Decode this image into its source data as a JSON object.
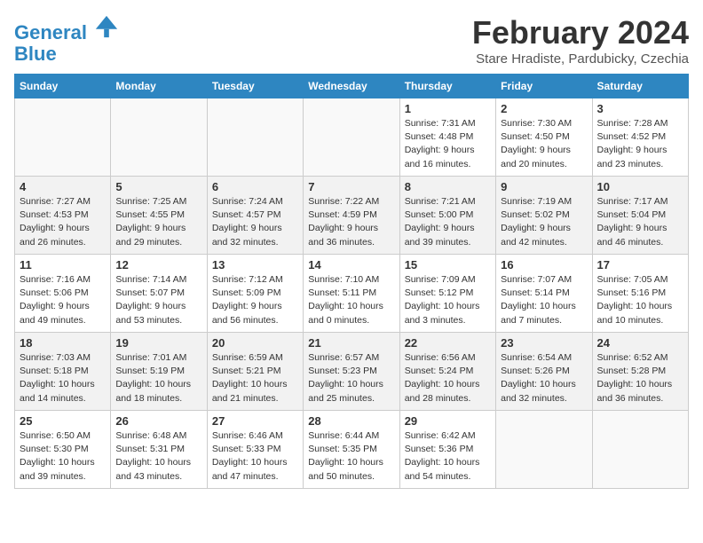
{
  "header": {
    "logo_line1": "General",
    "logo_line2": "Blue",
    "month": "February 2024",
    "location": "Stare Hradiste, Pardubicky, Czechia"
  },
  "days_of_week": [
    "Sunday",
    "Monday",
    "Tuesday",
    "Wednesday",
    "Thursday",
    "Friday",
    "Saturday"
  ],
  "weeks": [
    [
      {
        "day": "",
        "info": ""
      },
      {
        "day": "",
        "info": ""
      },
      {
        "day": "",
        "info": ""
      },
      {
        "day": "",
        "info": ""
      },
      {
        "day": "1",
        "info": "Sunrise: 7:31 AM\nSunset: 4:48 PM\nDaylight: 9 hours\nand 16 minutes."
      },
      {
        "day": "2",
        "info": "Sunrise: 7:30 AM\nSunset: 4:50 PM\nDaylight: 9 hours\nand 20 minutes."
      },
      {
        "day": "3",
        "info": "Sunrise: 7:28 AM\nSunset: 4:52 PM\nDaylight: 9 hours\nand 23 minutes."
      }
    ],
    [
      {
        "day": "4",
        "info": "Sunrise: 7:27 AM\nSunset: 4:53 PM\nDaylight: 9 hours\nand 26 minutes."
      },
      {
        "day": "5",
        "info": "Sunrise: 7:25 AM\nSunset: 4:55 PM\nDaylight: 9 hours\nand 29 minutes."
      },
      {
        "day": "6",
        "info": "Sunrise: 7:24 AM\nSunset: 4:57 PM\nDaylight: 9 hours\nand 32 minutes."
      },
      {
        "day": "7",
        "info": "Sunrise: 7:22 AM\nSunset: 4:59 PM\nDaylight: 9 hours\nand 36 minutes."
      },
      {
        "day": "8",
        "info": "Sunrise: 7:21 AM\nSunset: 5:00 PM\nDaylight: 9 hours\nand 39 minutes."
      },
      {
        "day": "9",
        "info": "Sunrise: 7:19 AM\nSunset: 5:02 PM\nDaylight: 9 hours\nand 42 minutes."
      },
      {
        "day": "10",
        "info": "Sunrise: 7:17 AM\nSunset: 5:04 PM\nDaylight: 9 hours\nand 46 minutes."
      }
    ],
    [
      {
        "day": "11",
        "info": "Sunrise: 7:16 AM\nSunset: 5:06 PM\nDaylight: 9 hours\nand 49 minutes."
      },
      {
        "day": "12",
        "info": "Sunrise: 7:14 AM\nSunset: 5:07 PM\nDaylight: 9 hours\nand 53 minutes."
      },
      {
        "day": "13",
        "info": "Sunrise: 7:12 AM\nSunset: 5:09 PM\nDaylight: 9 hours\nand 56 minutes."
      },
      {
        "day": "14",
        "info": "Sunrise: 7:10 AM\nSunset: 5:11 PM\nDaylight: 10 hours\nand 0 minutes."
      },
      {
        "day": "15",
        "info": "Sunrise: 7:09 AM\nSunset: 5:12 PM\nDaylight: 10 hours\nand 3 minutes."
      },
      {
        "day": "16",
        "info": "Sunrise: 7:07 AM\nSunset: 5:14 PM\nDaylight: 10 hours\nand 7 minutes."
      },
      {
        "day": "17",
        "info": "Sunrise: 7:05 AM\nSunset: 5:16 PM\nDaylight: 10 hours\nand 10 minutes."
      }
    ],
    [
      {
        "day": "18",
        "info": "Sunrise: 7:03 AM\nSunset: 5:18 PM\nDaylight: 10 hours\nand 14 minutes."
      },
      {
        "day": "19",
        "info": "Sunrise: 7:01 AM\nSunset: 5:19 PM\nDaylight: 10 hours\nand 18 minutes."
      },
      {
        "day": "20",
        "info": "Sunrise: 6:59 AM\nSunset: 5:21 PM\nDaylight: 10 hours\nand 21 minutes."
      },
      {
        "day": "21",
        "info": "Sunrise: 6:57 AM\nSunset: 5:23 PM\nDaylight: 10 hours\nand 25 minutes."
      },
      {
        "day": "22",
        "info": "Sunrise: 6:56 AM\nSunset: 5:24 PM\nDaylight: 10 hours\nand 28 minutes."
      },
      {
        "day": "23",
        "info": "Sunrise: 6:54 AM\nSunset: 5:26 PM\nDaylight: 10 hours\nand 32 minutes."
      },
      {
        "day": "24",
        "info": "Sunrise: 6:52 AM\nSunset: 5:28 PM\nDaylight: 10 hours\nand 36 minutes."
      }
    ],
    [
      {
        "day": "25",
        "info": "Sunrise: 6:50 AM\nSunset: 5:30 PM\nDaylight: 10 hours\nand 39 minutes."
      },
      {
        "day": "26",
        "info": "Sunrise: 6:48 AM\nSunset: 5:31 PM\nDaylight: 10 hours\nand 43 minutes."
      },
      {
        "day": "27",
        "info": "Sunrise: 6:46 AM\nSunset: 5:33 PM\nDaylight: 10 hours\nand 47 minutes."
      },
      {
        "day": "28",
        "info": "Sunrise: 6:44 AM\nSunset: 5:35 PM\nDaylight: 10 hours\nand 50 minutes."
      },
      {
        "day": "29",
        "info": "Sunrise: 6:42 AM\nSunset: 5:36 PM\nDaylight: 10 hours\nand 54 minutes."
      },
      {
        "day": "",
        "info": ""
      },
      {
        "day": "",
        "info": ""
      }
    ]
  ]
}
